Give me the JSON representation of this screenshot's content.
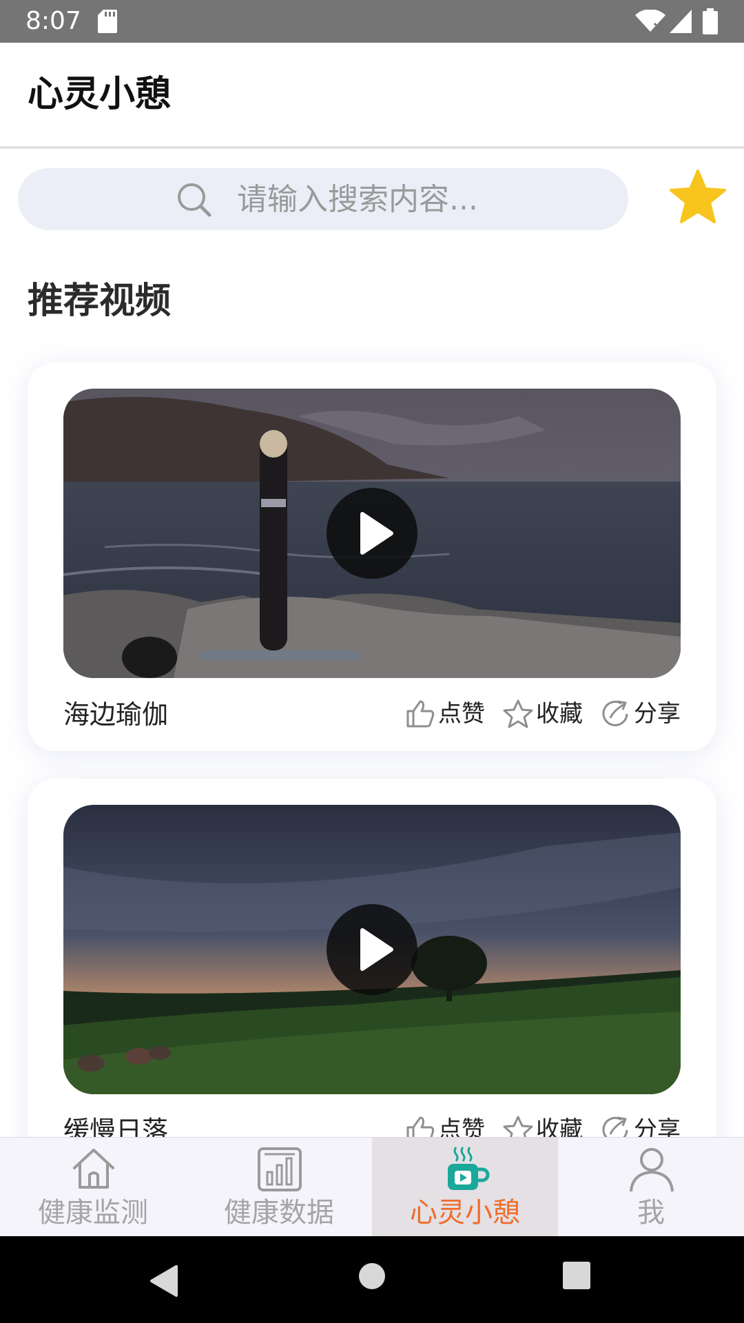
{
  "status_bar": {
    "time": "8:07"
  },
  "header": {
    "title": "心灵小憩"
  },
  "search": {
    "placeholder": "请输入搜索内容..."
  },
  "section": {
    "title": "推荐视频"
  },
  "videos": [
    {
      "title": "海边瑜伽",
      "actions": {
        "like": "点赞",
        "favorite": "收藏",
        "share": "分享"
      }
    },
    {
      "title": "缓慢日落",
      "actions": {
        "like": "点赞",
        "favorite": "收藏",
        "share": "分享"
      }
    }
  ],
  "bottom_nav": {
    "items": [
      {
        "label": "健康监测",
        "icon": "home-icon"
      },
      {
        "label": "健康数据",
        "icon": "bar-chart-icon"
      },
      {
        "label": "心灵小憩",
        "icon": "coffee-cup-icon",
        "active": true
      },
      {
        "label": "我",
        "icon": "person-icon"
      }
    ]
  },
  "colors": {
    "accent": "#f06c2c",
    "active_icon": "#1aa89a",
    "star": "#f7c51e",
    "search_bg": "#ebeef6"
  }
}
